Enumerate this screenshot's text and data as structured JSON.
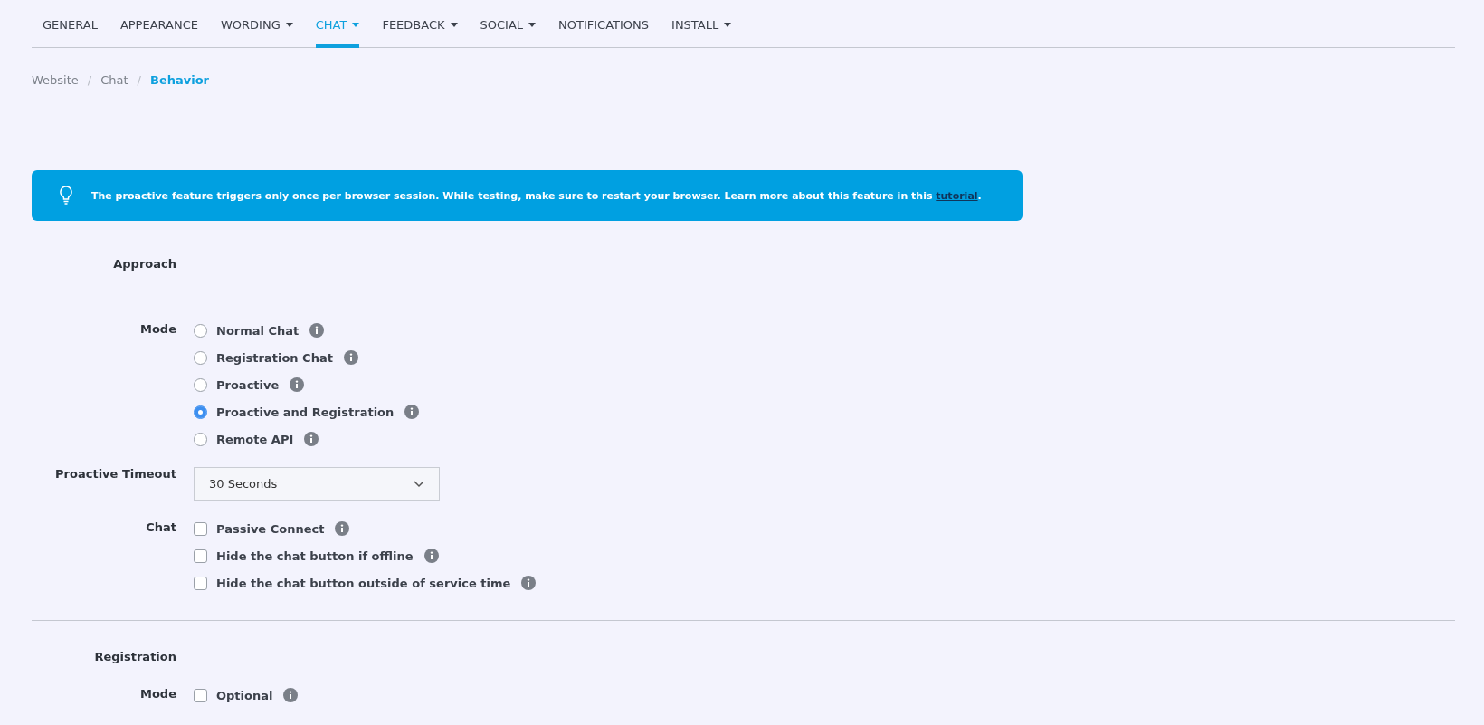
{
  "tabs": [
    {
      "label": "GENERAL",
      "selected": false,
      "dropdown": false
    },
    {
      "label": "APPEARANCE",
      "selected": false,
      "dropdown": false
    },
    {
      "label": "WORDING",
      "selected": false,
      "dropdown": true
    },
    {
      "label": "CHAT",
      "selected": true,
      "dropdown": true
    },
    {
      "label": "FEEDBACK",
      "selected": false,
      "dropdown": true
    },
    {
      "label": "SOCIAL",
      "selected": false,
      "dropdown": true
    },
    {
      "label": "NOTIFICATIONS",
      "selected": false,
      "dropdown": false
    },
    {
      "label": "INSTALL",
      "selected": false,
      "dropdown": true
    }
  ],
  "breadcrumb": [
    {
      "label": "Website",
      "current": false
    },
    {
      "separator": "/",
      "label": "Chat",
      "current": false
    },
    {
      "separator": "/",
      "label": "Behavior",
      "current": true
    }
  ],
  "notice": {
    "text": "The proactive feature triggers only once per browser session. While testing, make sure to restart your browser. Learn more about this feature in this ",
    "link": "tutorial",
    "after": "."
  },
  "sections": [
    {
      "title": "Approach",
      "fields": [
        {
          "kind": "radio",
          "label": "Mode",
          "options": [
            {
              "label": "Normal Chat",
              "selected": false
            },
            {
              "label": "Registration Chat",
              "selected": false
            },
            {
              "label": "Proactive",
              "selected": false
            },
            {
              "label": "Proactive and Registration",
              "selected": true
            },
            {
              "label": "Remote API",
              "selected": false
            }
          ]
        },
        {
          "kind": "select",
          "label": "Proactive Timeout",
          "value": "30 Seconds"
        },
        {
          "kind": "checkbox",
          "label": "Chat",
          "options": [
            {
              "label": "Passive Connect",
              "checked": false
            },
            {
              "label": "Hide the chat button if offline",
              "checked": false
            },
            {
              "label": "Hide the chat button outside of service time",
              "checked": false
            }
          ]
        }
      ]
    },
    {
      "title": "Registration",
      "fields": [
        {
          "kind": "checkbox",
          "label": "Mode",
          "options": [
            {
              "label": "Optional",
              "checked": false
            }
          ]
        }
      ]
    }
  ]
}
